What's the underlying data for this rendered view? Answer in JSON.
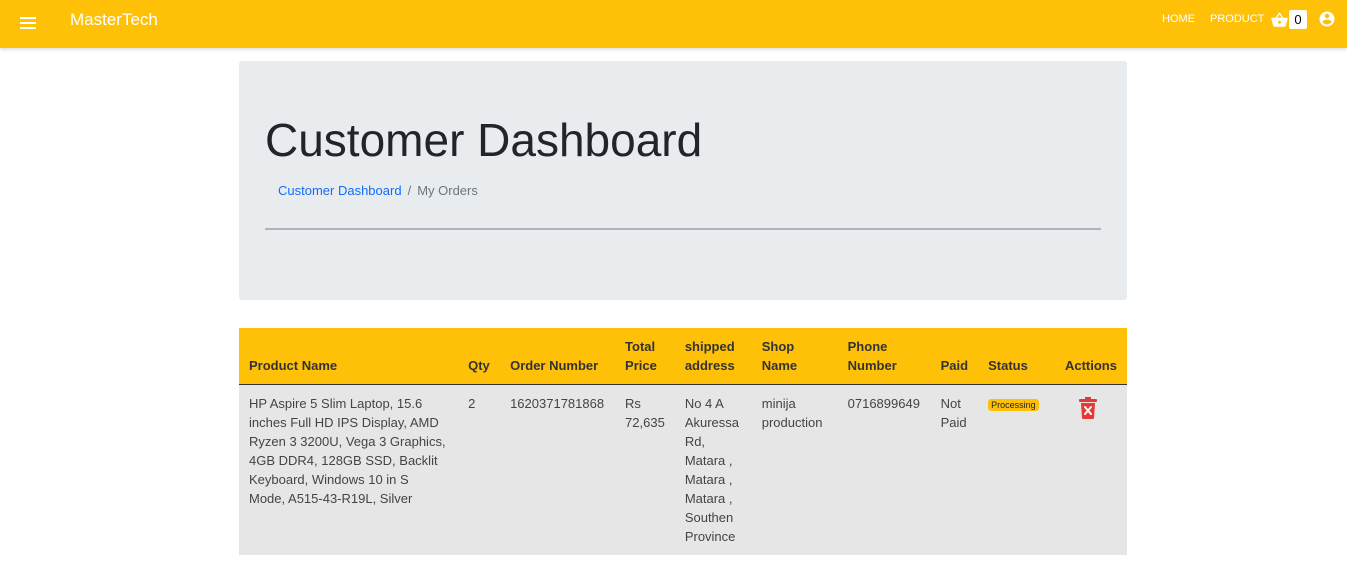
{
  "app": {
    "brand": "MasterTech",
    "nav": [
      {
        "label": "HOME"
      },
      {
        "label": "PRODUCT"
      }
    ],
    "cart_count": "0",
    "accent_color": "#fec107"
  },
  "header": {
    "title": "Customer Dashboard",
    "breadcrumb": {
      "link": "Customer Dashboard",
      "separator": "/",
      "current": "My Orders"
    }
  },
  "table": {
    "columns": [
      "Product Name",
      "Qty",
      "Order Number",
      "Total Price",
      "shipped address",
      "Shop Name",
      "Phone Number",
      "Paid",
      "Status",
      "Acttions"
    ],
    "rows": [
      {
        "product_name": "HP Aspire 5 Slim Laptop, 15.6 inches Full HD IPS Display, AMD Ryzen 3 3200U, Vega 3 Graphics, 4GB DDR4, 128GB SSD, Backlit Keyboard, Windows 10 in S Mode, A515-43-R19L, Silver",
        "qty": "2",
        "order_number": "1620371781868",
        "total_price": "Rs 72,635",
        "shipped_address": "No 4 A Akuressa Rd, Matara , Matara , Matara , Southen Province",
        "shop_name": "minija production",
        "phone_number": "0716899649",
        "paid": "Not Paid",
        "status": "Processing",
        "action_icon": "delete-icon"
      }
    ]
  }
}
